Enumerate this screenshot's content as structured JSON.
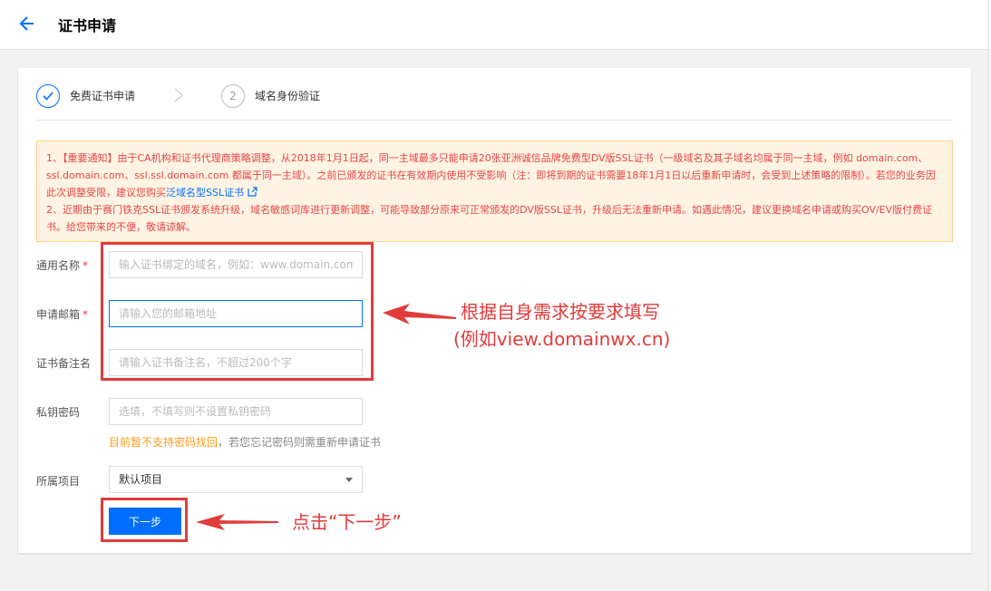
{
  "header": {
    "title": "证书申请"
  },
  "steps": [
    {
      "index": "",
      "label": "免费证书申请",
      "done": true
    },
    {
      "index": "2",
      "label": "域名身份验证",
      "done": false
    }
  ],
  "notice": {
    "p1": "1、【重要通知】由于CA机构和证书代理商策略调整，从2018年1月1日起，同一主域最多只能申请20张亚洲诚信品牌免费型DV版SSL证书（一级域名及其子域名均属于同一主域，例如 domain.com、ssl.domain.com、ssl.ssl.domain.com 都属于同一主域）。之前已颁发的证书在有效期内使用不受影响（注：即将到期的证书需要18年1月1日以后重新申请时，会受到上述策略的限制）。若您的业务因此次调整受限，建议您购买",
    "link": "泛域名型SSL证书",
    "p2": "2、近期由于赛门铁克SSL证书颁发系统升级，域名敏感词库进行更新调整，可能导致部分原来可正常颁发的DV版SSL证书，升级后无法重新申请。如遇此情况，建议更换域名申请或购买OV/EV版付费证书。给您带来的不便，敬请谅解。"
  },
  "form": {
    "common_name": {
      "label": "通用名称",
      "placeholder": "输入证书绑定的域名，例如：www.domain.com",
      "value": ""
    },
    "email": {
      "label": "申请邮箱",
      "placeholder": "请输入您的邮箱地址",
      "value": ""
    },
    "remark": {
      "label": "证书备注名",
      "placeholder": "请输入证书备注名，不超过200个字",
      "value": ""
    },
    "private_key_password": {
      "label": "私钥密码",
      "placeholder": "选填，不填写则不设置私钥密码",
      "value": ""
    },
    "hint_warn": "目前暂不支持密码找回",
    "hint_rest": "，若您忘记密码则需重新申请证书",
    "project": {
      "label": "所属项目",
      "selected": "默认项目"
    },
    "required_mark": "*",
    "next_label": "下一步"
  },
  "annotations": {
    "fill_line1": "根据自身需求按要求填写",
    "fill_line2": "(例如view.domainwx.cn)",
    "click_next": "点击“下一步”"
  },
  "colors": {
    "primary": "#006eff",
    "annotation": "#e23b3b",
    "notice_text": "#e54545",
    "notice_bg": "#fff4e3",
    "hint_warn": "#ff9c19"
  }
}
